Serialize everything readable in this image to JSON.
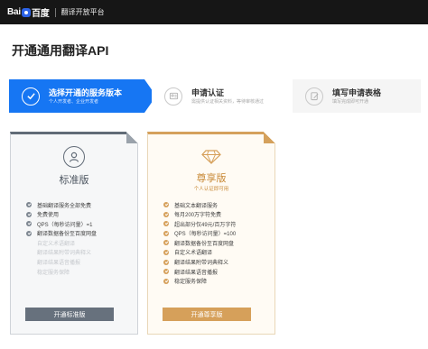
{
  "header": {
    "logo_left": "Bai",
    "logo_right": "百度",
    "platform": "翻译开放平台"
  },
  "page_title": "开通通用翻译API",
  "steps": [
    {
      "title": "选择开通的服务版本",
      "subtitle": "个人开发者、企业开发者",
      "active": true,
      "icon": "check-circle-icon"
    },
    {
      "title": "申请认证",
      "subtitle": "需提供认证相关资料，等待审核通过",
      "active": false,
      "icon": "id-card-icon"
    },
    {
      "title": "填写申请表格",
      "subtitle": "填写完成即可开通",
      "active": false,
      "icon": "edit-form-icon"
    }
  ],
  "plans": {
    "standard": {
      "name": "标准版",
      "icon": "user-icon",
      "features": [
        {
          "text": "基础翻译服务全部免费",
          "enabled": true
        },
        {
          "text": "免费使用",
          "enabled": true
        },
        {
          "text": "QPS（每秒访问量）=1",
          "enabled": true
        },
        {
          "text": "翻译数据备份至百度网盘",
          "enabled": true
        },
        {
          "text": "自定义术语翻译",
          "enabled": false
        },
        {
          "text": "翻译结果附带词典释义",
          "enabled": false
        },
        {
          "text": "翻译结果语音播报",
          "enabled": false
        },
        {
          "text": "稳定服务保障",
          "enabled": false
        }
      ],
      "button": "开通标准版"
    },
    "premium": {
      "name": "尊享版",
      "subtitle": "个人认证即可用",
      "icon": "diamond-icon",
      "features": [
        {
          "text": "基础文本翻译服务",
          "enabled": true
        },
        {
          "text": "每月200万字符免费",
          "enabled": true
        },
        {
          "text": "超出部分仅49元/百万字符",
          "enabled": true
        },
        {
          "text": "QPS（每秒访问量）=100",
          "enabled": true
        },
        {
          "text": "翻译数据备份至百度网盘",
          "enabled": true
        },
        {
          "text": "自定义术语翻译",
          "enabled": true
        },
        {
          "text": "翻译结果附带词典释义",
          "enabled": true
        },
        {
          "text": "翻译结果语音播报",
          "enabled": true
        },
        {
          "text": "稳定服务保障",
          "enabled": true
        }
      ],
      "button": "开通尊享版"
    }
  },
  "colors": {
    "accent": "#1676f3",
    "standard": "#67717d",
    "premium": "#d6a05a",
    "topbar": "#161616"
  }
}
